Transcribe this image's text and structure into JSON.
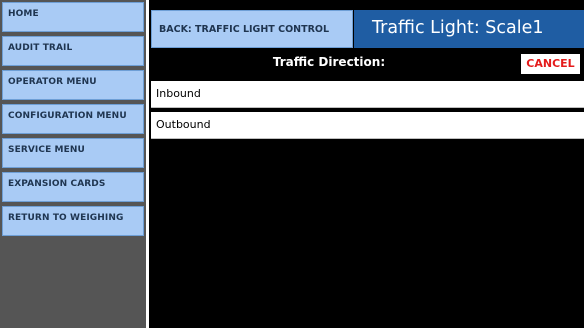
{
  "sidebar": {
    "items": [
      {
        "label": "HOME"
      },
      {
        "label": "AUDIT TRAIL"
      },
      {
        "label": "OPERATOR MENU"
      },
      {
        "label": "CONFIGURATION MENU"
      },
      {
        "label": "SERVICE MENU"
      },
      {
        "label": "EXPANSION CARDS"
      },
      {
        "label": "RETURN TO WEIGHING"
      }
    ]
  },
  "header": {
    "back_label": "BACK: TRAFFIC LIGHT CONTROL",
    "title": "Traffic Light: Scale1"
  },
  "panel": {
    "heading": "Traffic Direction:",
    "cancel_label": "CANCEL",
    "options": [
      {
        "label": "Inbound"
      },
      {
        "label": "Outbound"
      }
    ]
  },
  "colors": {
    "button_bg": "#a9cbf5",
    "title_bg": "#1f5da3",
    "cancel_text": "#e41b1b",
    "main_bg": "#000000",
    "sidebar_bg": "#555555"
  }
}
